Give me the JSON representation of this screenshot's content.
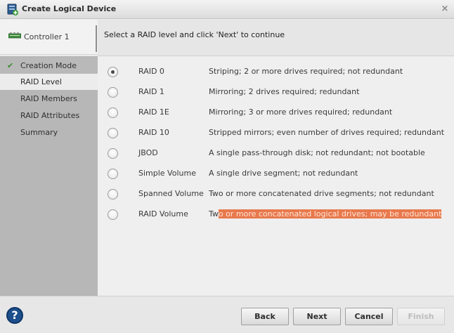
{
  "window": {
    "title": "Create Logical Device",
    "close_icon": "×"
  },
  "header": {
    "controller_label": "Controller 1",
    "instruction": "Select a RAID level and click 'Next' to continue"
  },
  "sidebar": {
    "items": [
      {
        "label": "Creation Mode",
        "state": "completed",
        "check": "✔"
      },
      {
        "label": "RAID Level",
        "state": "active"
      },
      {
        "label": "RAID Members",
        "state": "pending"
      },
      {
        "label": "RAID Attributes",
        "state": "pending"
      },
      {
        "label": "Summary",
        "state": "pending"
      }
    ]
  },
  "raid_options": [
    {
      "label": "RAID 0",
      "description": "Striping; 2 or more drives required; not redundant",
      "selected": true
    },
    {
      "label": "RAID 1",
      "description": "Mirroring; 2 drives required; redundant",
      "selected": false
    },
    {
      "label": "RAID 1E",
      "description": "Mirroring; 3 or more drives required; redundant",
      "selected": false
    },
    {
      "label": "RAID 10",
      "description": "Stripped mirrors; even number of drives required; redundant",
      "selected": false
    },
    {
      "label": "JBOD",
      "description": "A single pass-through disk; not redundant; not bootable",
      "selected": false
    },
    {
      "label": "Simple Volume",
      "description": "A single drive segment; not redundant",
      "selected": false
    },
    {
      "label": "Spanned Volume",
      "description": "Two or more concatenated drive segments; not redundant",
      "selected": false
    },
    {
      "label": "RAID Volume",
      "description_prefix": "Tw",
      "description_highlight": "o or more concatenated logical drives; may be redundant",
      "selected": false
    }
  ],
  "footer": {
    "help": "?",
    "back_label": "Back",
    "next_label": "Next",
    "cancel_label": "Cancel",
    "finish_label": "Finish",
    "finish_enabled": false
  },
  "colors": {
    "highlight": "#e8794c",
    "sidebar_bg": "#b7b7b7",
    "help_icon": "#1d4f8c",
    "check": "#3c8a2f"
  }
}
